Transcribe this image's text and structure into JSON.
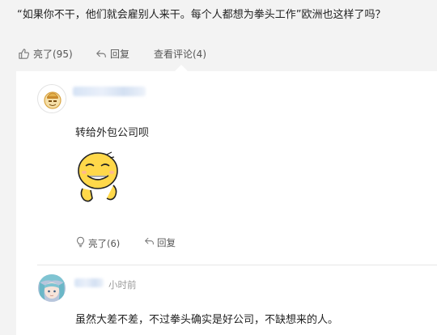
{
  "post": {
    "text": "“如果你不干，他们就会雇别人来干。每个人都想为拳头工作”欧洲也这样了吗？",
    "like_label": "亮了(95)",
    "reply_label": "回复",
    "comments_label": "查看评论(4)"
  },
  "comments": [
    {
      "text": "转给外包公司呗",
      "like_label": "亮了(6)",
      "reply_label": "回复"
    },
    {
      "time": "小时前",
      "text": "虽然大差不差，不过拳头确实是好公司，不缺想来的人。"
    }
  ],
  "colors": {
    "page_bg": "#f3f3f3",
    "panel_bg": "#ffffff",
    "text": "#222222",
    "muted": "#555555",
    "time": "#999999"
  },
  "icons": [
    "thumbs-up-icon",
    "reply-arrow-icon",
    "light-bulb-icon"
  ]
}
